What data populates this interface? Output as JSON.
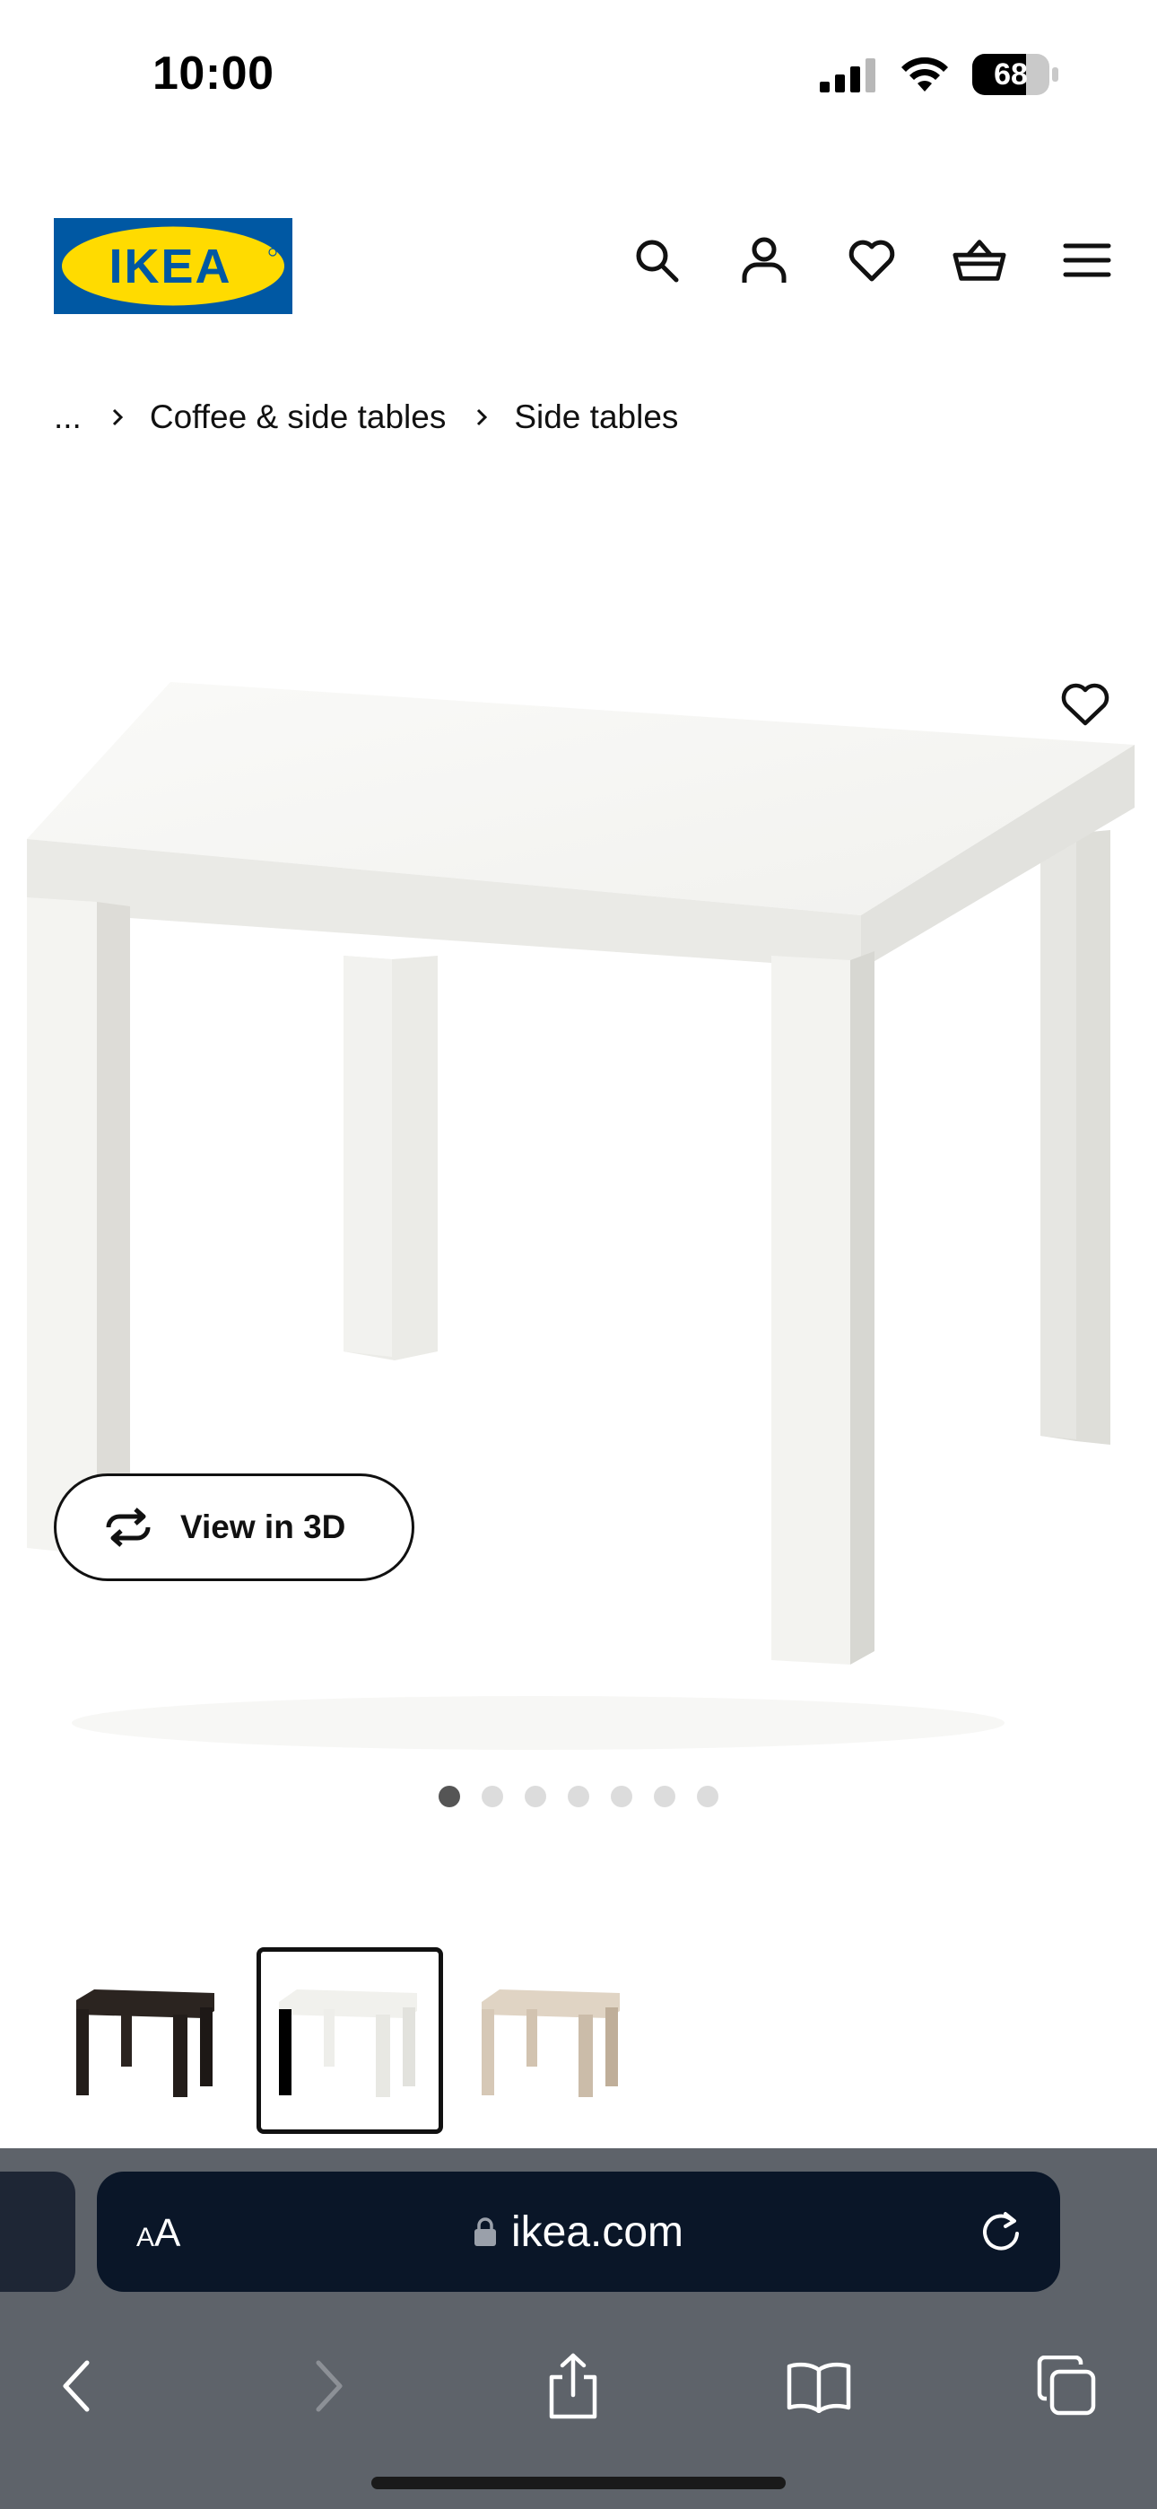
{
  "status_bar": {
    "time": "10:00",
    "battery": "68",
    "icons": [
      "cellular-signal-icon",
      "wifi-icon",
      "battery-icon"
    ]
  },
  "header": {
    "logo_text": "IKEA",
    "logo_colors": {
      "background": "#0058a3",
      "ellipse": "#ffdb00",
      "text": "#0058a3"
    },
    "icons": [
      "search-icon",
      "account-icon",
      "heart-icon",
      "basket-icon",
      "menu-icon"
    ]
  },
  "breadcrumb": {
    "items": [
      "...",
      "Coffee & side tables",
      "Side tables"
    ]
  },
  "product": {
    "favorite_icon": "heart-outline-icon",
    "view3d_label": "View in 3D",
    "view3d_icon": "rotate-icon",
    "image_count": 7,
    "active_image_index": 0
  },
  "variants": {
    "items": [
      {
        "color_name": "black-brown",
        "swatch": "#2b2420"
      },
      {
        "color_name": "white",
        "swatch": "#f2f2ee"
      },
      {
        "color_name": "white stained oak effect",
        "swatch": "#d6c8b6"
      }
    ],
    "selected_index": 1
  },
  "browser": {
    "text_size_small": "A",
    "text_size_big": "A",
    "url": "ikea.com",
    "colors": {
      "chrome": "#5e636a",
      "address_bar": "#0a1628"
    },
    "toolbar_icons": [
      "back-icon",
      "forward-icon",
      "share-icon",
      "bookmarks-icon",
      "tabs-icon"
    ]
  }
}
